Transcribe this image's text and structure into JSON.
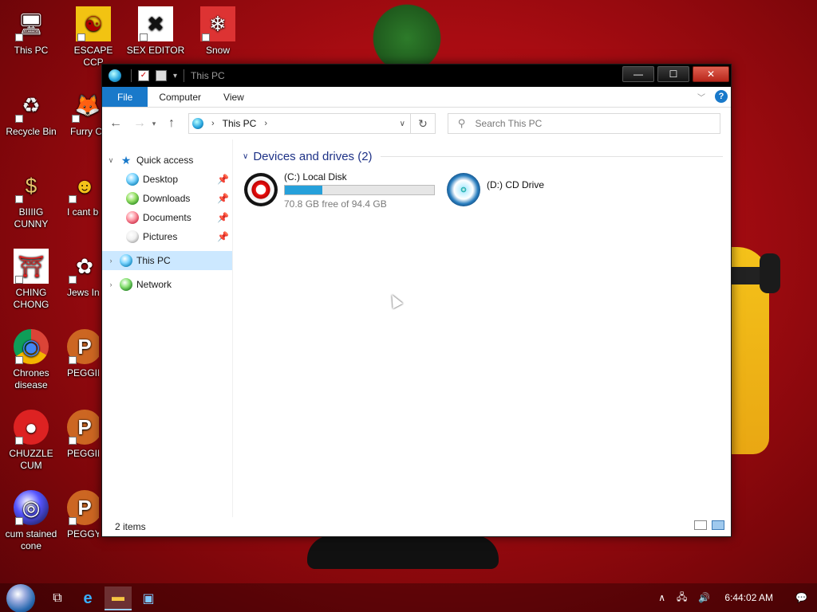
{
  "desktop": {
    "icons": [
      {
        "label": "This PC",
        "glyph": "🖥"
      },
      {
        "label": "ESCAPE CCP",
        "glyph": "☯"
      },
      {
        "label": "SEX EDITOR",
        "glyph": "✖"
      },
      {
        "label": "Snow",
        "glyph": "❄"
      },
      {
        "label": "Recycle Bin",
        "glyph": "♻"
      },
      {
        "label": "Furry Co",
        "glyph": "🦊"
      },
      {
        "label": "BIIIIG CUNNY",
        "glyph": "$"
      },
      {
        "label": "I cant be how FUC",
        "glyph": "☻"
      },
      {
        "label": "CHING CHONG",
        "glyph": "⛩"
      },
      {
        "label": "Jews Inv Palesti",
        "glyph": "✿"
      },
      {
        "label": "Chrones disease",
        "glyph": "◉"
      },
      {
        "label": "PEGGII LMFAOO",
        "glyph": "P"
      },
      {
        "label": "CHUZZLE CUM",
        "glyph": "●"
      },
      {
        "label": "PEGGING",
        "glyph": "P"
      },
      {
        "label": "cum stained cone",
        "glyph": "◎"
      },
      {
        "label": "PEGGY HILL",
        "glyph": "P"
      }
    ]
  },
  "window": {
    "title": "This PC",
    "controls": {
      "minimize": "—",
      "maximize": "☐",
      "close": "✕"
    },
    "ribbon": {
      "tabs": [
        "File",
        "Computer",
        "View"
      ],
      "help": "?"
    },
    "address": {
      "crumbs": [
        "This PC"
      ],
      "search_placeholder": "Search This PC"
    },
    "nav_pane": {
      "quick_access": "Quick access",
      "quick_items": [
        "Desktop",
        "Downloads",
        "Documents",
        "Pictures"
      ],
      "this_pc": "This PC",
      "network": "Network"
    },
    "content": {
      "group_title": "Devices and drives (2)",
      "drives": [
        {
          "name": "(C:) Local Disk",
          "free_text": "70.8 GB free of 94.4 GB",
          "used_fraction": 0.25
        },
        {
          "name": "(D:) CD Drive"
        }
      ]
    },
    "status": {
      "items": "2 items"
    }
  },
  "taskbar": {
    "clock": "6:44:02 AM",
    "tray_icons": [
      "chevron-up-icon",
      "network-icon",
      "volume-icon",
      "notification-icon"
    ]
  },
  "colors": {
    "accent": "#1979ca",
    "selection": "#cce8ff",
    "bar_fill": "#26a0da",
    "group_title": "#1e3287"
  }
}
